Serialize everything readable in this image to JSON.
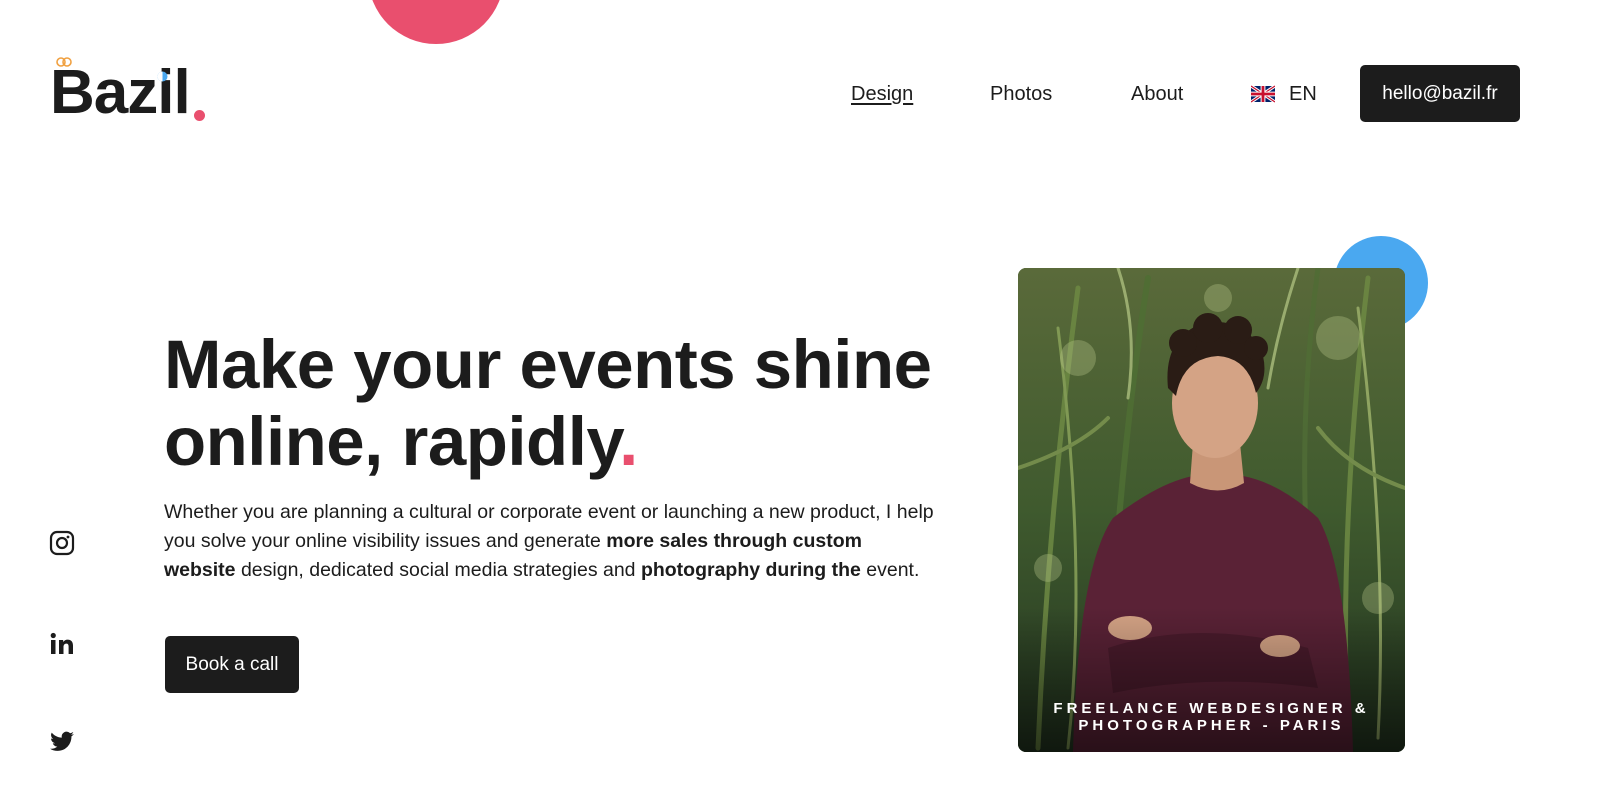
{
  "logo": {
    "text": "Bazil",
    "dot": "."
  },
  "nav": {
    "items": [
      {
        "label": "Design",
        "active": true
      },
      {
        "label": "Photos",
        "active": false
      },
      {
        "label": "About",
        "active": false
      }
    ],
    "language": {
      "code": "EN",
      "flag_icon": "uk-flag-icon"
    },
    "contact_button": "hello@bazil.fr"
  },
  "hero": {
    "headline_line1": "Make your events shine",
    "headline_line2": "online, rapidly",
    "headline_dot": ".",
    "lead": [
      "Whether you are planning a cultural or corporate event or launching a new product, I help you solve your online visibility issues and generate ",
      "more sales through custom website",
      " design, dedicated social media strategies and ",
      "photography during the",
      " event."
    ],
    "cta": "Book a call"
  },
  "socials": [
    {
      "icon": "instagram-icon"
    },
    {
      "icon": "linkedin-icon"
    },
    {
      "icon": "twitter-icon"
    }
  ],
  "portrait": {
    "caption_line1": "FREELANCE WEBDESIGNER &",
    "caption_line2": "PHOTOGRAPHER - PARIS"
  },
  "colors": {
    "accent_pink": "#e94f6e",
    "accent_blue": "#4aa8f0",
    "accent_orange": "#f0a040",
    "dark": "#1c1c1c"
  }
}
